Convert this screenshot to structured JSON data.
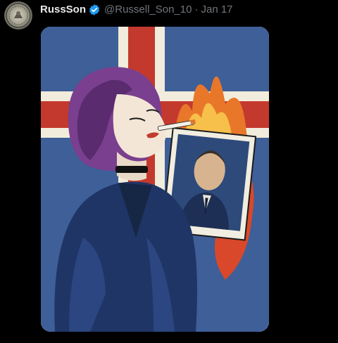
{
  "tweet": {
    "display_name": "RussSon",
    "handle": "@Russell_Son_10",
    "separator": "·",
    "date": "Jan 17",
    "verified": true,
    "avatar_icon": "coin-seal-avatar",
    "media_alt_icon": "pop-art-illustration"
  },
  "colors": {
    "background": "#000000",
    "name": "#e7e9ea",
    "meta": "#71767b",
    "verified": "#1d9bf0",
    "flag_blue": "#3b5a94",
    "flag_red": "#c0392b"
  }
}
